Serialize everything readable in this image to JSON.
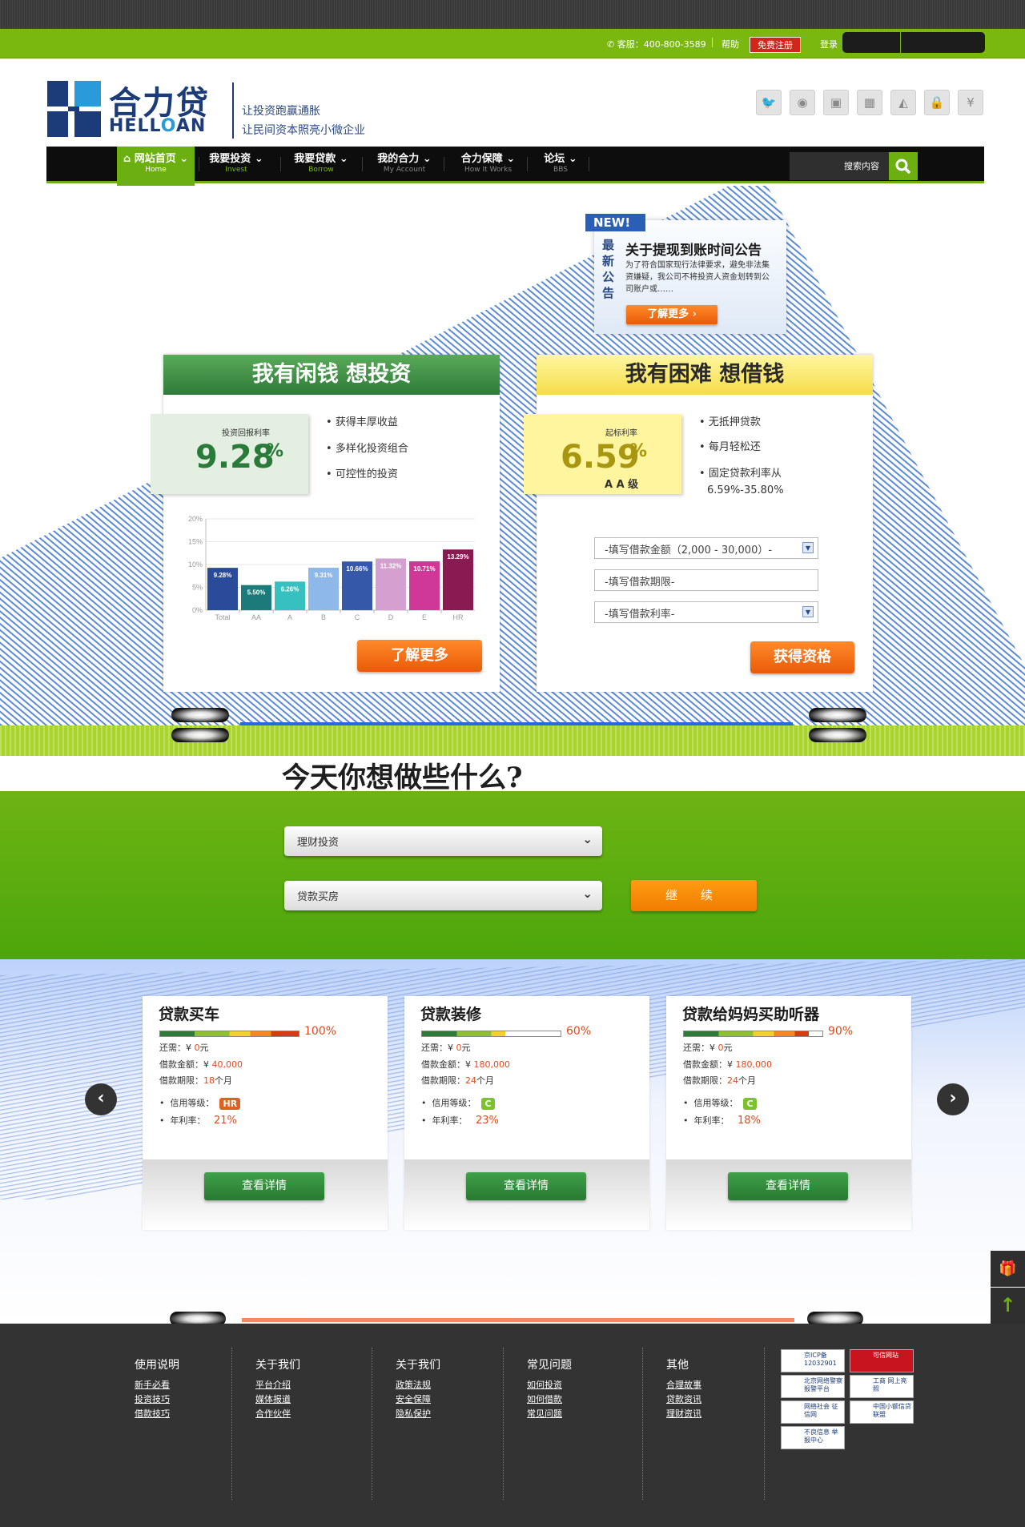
{
  "topbar": {
    "hotline": "客服：400-800-3589",
    "help": "帮助",
    "register": "免费注册",
    "login": "登录"
  },
  "logo": {
    "cn": "合力贷",
    "en_left": "HELL",
    "en_o": "O",
    "en_right": "AN",
    "slogan1": "让投资跑赢通胀",
    "slogan2": "让民间资本照亮小微企业"
  },
  "social_icons": [
    "twitter-icon",
    "weibo-icon",
    "camera-icon",
    "photo-icon",
    "map-icon",
    "lock-icon",
    "yen-icon"
  ],
  "nav": {
    "items": [
      {
        "cn": "网站首页",
        "en": "Home"
      },
      {
        "cn": "我要投资",
        "en": "Invest"
      },
      {
        "cn": "我要贷款",
        "en": "Borrow"
      },
      {
        "cn": "我的合力",
        "en": "My Account"
      },
      {
        "cn": "合力保障",
        "en": "How It Works"
      },
      {
        "cn": "论坛",
        "en": "BBS"
      }
    ],
    "search_placeholder": "搜索内容"
  },
  "notice": {
    "new": "NEW!",
    "side": "最新公告",
    "title": "关于提现到账时间公告",
    "body": "为了符合国家现行法律要求，避免非法集资嫌疑，我公司不将投资人资金划转到公司账户或……",
    "btn": "了解更多"
  },
  "invest": {
    "title": "我有闲钱  想投资",
    "rate_label": "投资回报利率",
    "rate": "9.28",
    "pct": "%",
    "bullets": [
      "获得丰厚收益",
      "多样化投资组合",
      "可控性的投资"
    ],
    "btn": "了解更多"
  },
  "loan": {
    "title": "我有困难 想借钱",
    "rate_label": "起标利率",
    "rate": "6.59",
    "pct": "%",
    "grade": "A A 级",
    "bullets": [
      "无抵押贷款",
      "每月轻松还",
      "固定贷款利率从"
    ],
    "range": "6.59%-35.80%",
    "select_amount": "-填写借款金额（2,000 - 30,000）-",
    "select_period": "-填写借款期限-",
    "select_rate": "-填写借款利率-",
    "btn": "获得资格"
  },
  "chart_data": {
    "type": "bar",
    "categories": [
      "Total",
      "AA",
      "A",
      "B",
      "C",
      "D",
      "E",
      "HR"
    ],
    "values": [
      9.28,
      5.5,
      6.26,
      9.31,
      10.66,
      11.32,
      10.71,
      13.29
    ],
    "labels": [
      "9.28%",
      "5.50%",
      "6.26%",
      "9.31%",
      "10.66%",
      "11.32%",
      "10.71%",
      "13.29%"
    ],
    "colors": [
      "#2a4a9a",
      "#1d7a7a",
      "#36c0c0",
      "#8fb8ea",
      "#3558a8",
      "#d4a0d0",
      "#d03898",
      "#8a1a52"
    ],
    "yticks": [
      "20%",
      "15%",
      "10%",
      "5%",
      "0%"
    ],
    "ylim": [
      0,
      20
    ]
  },
  "today": {
    "title": "今天你想做些什么?",
    "dd1": "理财投资",
    "dd2": "贷款买房",
    "continue": "继 续"
  },
  "loans": [
    {
      "title": "贷款买车",
      "pct": "100%",
      "progress": 1.0,
      "need_label": "还需：¥ ",
      "need": "0",
      "need_unit": "元",
      "amount_label": "借款金额：¥ ",
      "amount": "40,000",
      "period_label": "借款期限：",
      "period": "18",
      "period_unit": "个月",
      "grade_label": "信用等级：",
      "grade": "HR",
      "grade_color": "#e06020",
      "rate_label": "年利率：",
      "rate": "21%",
      "btn": "查看详情"
    },
    {
      "title": "贷款装修",
      "pct": "60%",
      "progress": 0.6,
      "need_label": "还需：¥ ",
      "need": "0",
      "need_unit": "元",
      "amount_label": "借款金额：¥ ",
      "amount": "180,000",
      "period_label": "借款期限：",
      "period": "24",
      "period_unit": "个月",
      "grade_label": "信用等级：",
      "grade": "C",
      "grade_color": "#7cc22a",
      "rate_label": "年利率：",
      "rate": "23%",
      "btn": "查看详情"
    },
    {
      "title": "贷款给妈妈买助听器",
      "pct": "90%",
      "progress": 0.9,
      "need_label": "还需：¥ ",
      "need": "0",
      "need_unit": "元",
      "amount_label": "借款金额：¥ ",
      "amount": "180,000",
      "period_label": "借款期限：",
      "period": "24",
      "period_unit": "个月",
      "grade_label": "信用等级：",
      "grade": "C",
      "grade_color": "#7cc22a",
      "rate_label": "年利率：",
      "rate": "18%",
      "btn": "查看详情"
    }
  ],
  "footer": {
    "cols": [
      {
        "h": "使用说明",
        "links": [
          "新手必看",
          "投资技巧",
          "借款技巧"
        ]
      },
      {
        "h": "关于我们",
        "links": [
          "平台介绍",
          "媒体报道",
          "合作伙伴"
        ]
      },
      {
        "h": "关于我们",
        "links": [
          "政策法规",
          "安全保障",
          "隐私保护"
        ]
      },
      {
        "h": "常见问题",
        "links": [
          "如何投资",
          "如何借款",
          "常见问题"
        ]
      },
      {
        "h": "其他",
        "links": [
          "合理故事",
          "贷款资讯",
          "理财资讯"
        ]
      }
    ],
    "badges": [
      "京ICP备 12032901",
      "可信网站",
      "北京网络警察报警平台",
      "工商 网上亮照",
      "网络社会 征信网",
      "中国小额信贷联盟",
      "不良信息 举报中心"
    ]
  }
}
